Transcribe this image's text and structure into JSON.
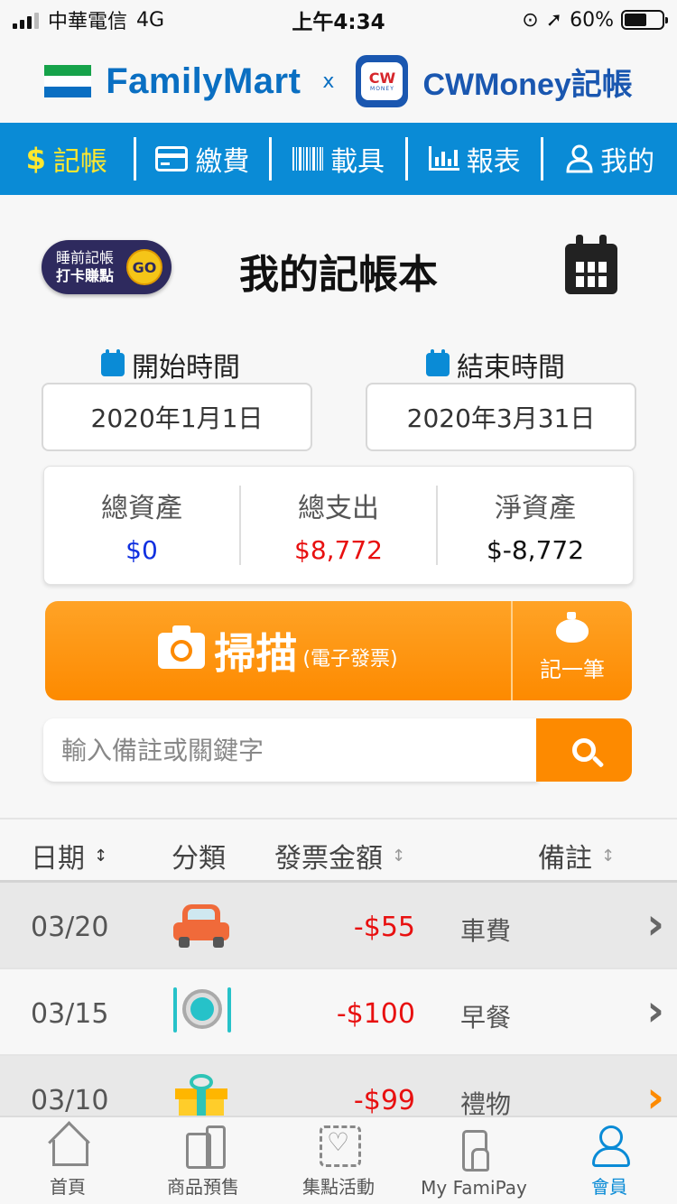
{
  "status_bar": {
    "carrier": "中華電信",
    "network": "4G",
    "time": "上午4:34",
    "battery": "60%"
  },
  "brand": {
    "familymart": "FamilyMart",
    "x": "x",
    "cw_badge": "CW",
    "cw_badge_sub": "MONEY",
    "cwmoney": "CWMoney記帳"
  },
  "nav": {
    "items": [
      {
        "icon": "dollar-icon",
        "glyph": "$",
        "label": "記帳"
      },
      {
        "icon": "card-icon",
        "glyph": "▭",
        "label": "繳費"
      },
      {
        "icon": "barcode-icon",
        "glyph": "||||",
        "label": "載具"
      },
      {
        "icon": "bar-chart-icon",
        "glyph": "▐▌",
        "label": "報表"
      },
      {
        "icon": "user-icon",
        "glyph": "◯",
        "label": "我的"
      }
    ]
  },
  "header": {
    "badge_line1": "睡前記帳",
    "badge_line2": "打卡賺點",
    "badge_go": "GO",
    "title": "我的記帳本"
  },
  "dates": {
    "start_label": "開始時間",
    "end_label": "結束時間",
    "start_value": "2020年1月1日",
    "end_value": "2020年3月31日"
  },
  "summary": {
    "assets_label": "總資產",
    "assets_value": "$0",
    "expense_label": "總支出",
    "expense_value": "$8,772",
    "net_label": "淨資產",
    "net_value": "$-8,772"
  },
  "actions": {
    "scan_label": "掃描",
    "scan_sub": "(電子發票)",
    "record_label": "記一筆"
  },
  "search": {
    "placeholder": "輸入備註或關鍵字"
  },
  "table": {
    "headers": {
      "date": "日期",
      "category": "分類",
      "amount": "發票金額",
      "note": "備註"
    },
    "sort_glyph": "↕",
    "rows": [
      {
        "date": "03/20",
        "icon": "car-icon",
        "amount": "-$55",
        "note": "車費"
      },
      {
        "date": "03/15",
        "icon": "plate-icon",
        "amount": "-$100",
        "note": "早餐"
      },
      {
        "date": "03/10",
        "icon": "gift-icon",
        "amount": "-$99",
        "note": "禮物"
      }
    ],
    "chevron": "›"
  },
  "tabbar": {
    "items": [
      {
        "icon": "home-icon",
        "label": "首頁"
      },
      {
        "icon": "shopping-icon",
        "label": "商品預售"
      },
      {
        "icon": "stamp-icon",
        "label": "集點活動"
      },
      {
        "icon": "phone-pay-icon",
        "label": "My FamiPay"
      },
      {
        "icon": "member-icon",
        "label": "會員"
      }
    ]
  },
  "colors": {
    "nav_blue": "#0a8bd6",
    "active_yellow": "#ffe82e",
    "orange": "#fd8a00",
    "expense_red": "#e81010",
    "asset_blue": "#1030e0"
  }
}
